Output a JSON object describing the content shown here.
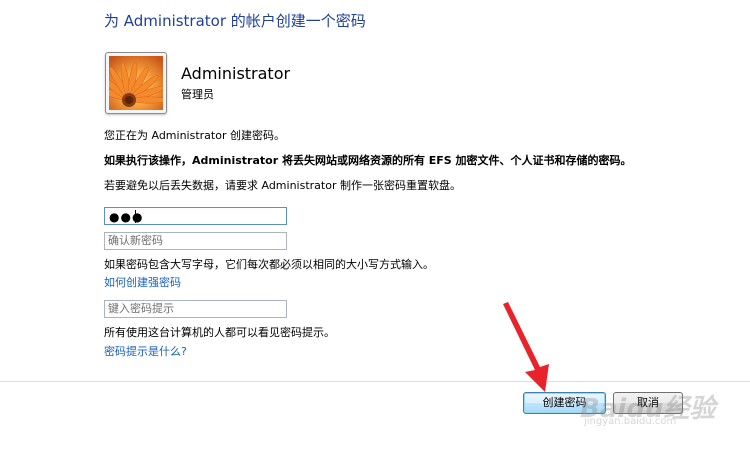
{
  "dialog": {
    "title": "为 Administrator 的帐户创建一个密码",
    "account_name": "Administrator",
    "account_role": "管理员",
    "intro": "您正在为 Administrator 创建密码。",
    "warning": "如果执行该操作，Administrator 将丢失网站或网络资源的所有 EFS 加密文件、个人证书和存储的密码。",
    "advice": "若要避免以后丢失数据，请要求 Administrator 制作一张密码重置软盘。",
    "password_mask": "●●●",
    "confirm_placeholder": "确认新密码",
    "case_note": "如果密码包含大写字母，它们每次都必须以相同的大小写方式输入。",
    "strong_link": "如何创建强密码",
    "hint_placeholder": "键入密码提示",
    "hint_note": "所有使用这台计算机的人都可以看见密码提示。",
    "hint_link": "密码提示是什么?",
    "create_button": "创建密码",
    "cancel_button": "取消"
  },
  "watermark": {
    "main": "Baidu经验",
    "sub": "jingyan.baidu.com"
  },
  "colors": {
    "title": "#1e3f9b",
    "link": "#1560bd",
    "arrow": "#e8232a"
  },
  "icons": {
    "avatar": "orange-flower-picture",
    "pointer": "red-arrow"
  }
}
